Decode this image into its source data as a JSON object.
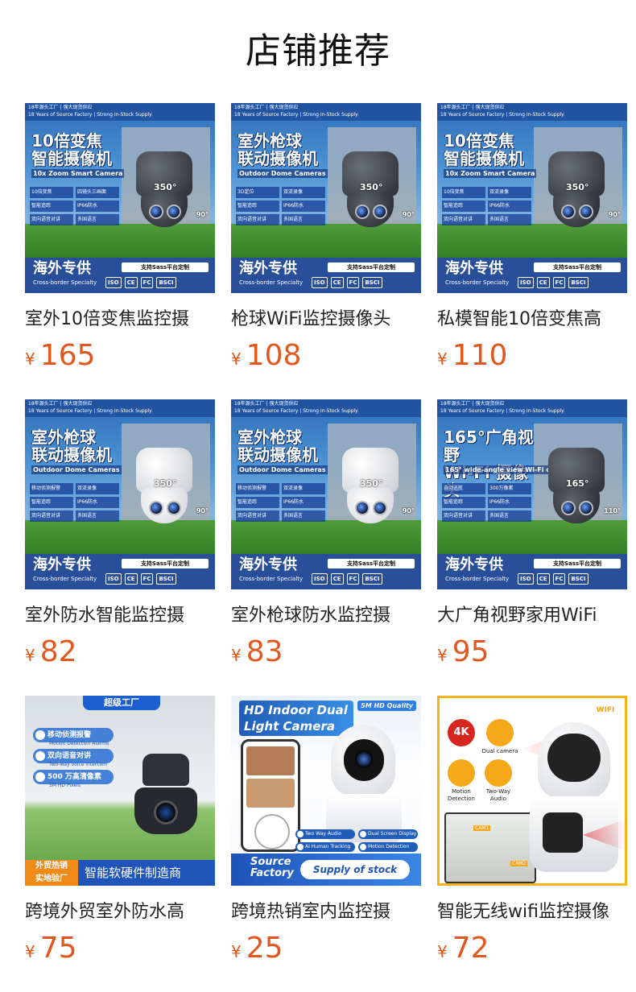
{
  "section_title": "店铺推荐",
  "currency_symbol": "¥",
  "products": [
    {
      "name": "室外10倍变焦监控摄",
      "price": "165",
      "image": {
        "style": "banner",
        "top_line1": "18年源头工厂 | 强大现货供应",
        "top_line2": "18 Years of Source Factory | Strong In-Stock Supply",
        "headline": "10倍变焦\n智能摄像机",
        "subtitle": "10x Zoom Smart Camera",
        "features": [
          "10倍变焦",
          "四镜头三画面",
          "智能追踪",
          "IP66防水",
          "双向语音对讲",
          "多国语言"
        ],
        "angle": "350°",
        "angle2": "90°",
        "brand": "海外专供",
        "brand_sub": "Cross-border Specialty",
        "tag": "支持Sass平台定制",
        "certs": [
          "ISO",
          "CE",
          "FC",
          "BSCI"
        ],
        "camera_color": "dark",
        "icon": "security-camera-icon"
      }
    },
    {
      "name": "枪球WiFi监控摄像头",
      "price": "108",
      "image": {
        "style": "banner",
        "top_line1": "18年源头工厂 | 强大现货供应",
        "top_line2": "18 Years of Source Factory | Strong In-Stock Supply",
        "headline": "室外枪球\n联动摄像机",
        "subtitle": "Outdoor Dome Cameras",
        "features": [
          "3D定位",
          "双流录像",
          "智能追踪",
          "IP66防水",
          "双向语音对讲",
          "多国语言"
        ],
        "angle": "350°",
        "angle2": "90°",
        "brand": "海外专供",
        "brand_sub": "Cross-border Specialty",
        "tag": "支持Sass平台定制",
        "certs": [
          "ISO",
          "CE",
          "FC",
          "BSCI"
        ],
        "camera_color": "dark",
        "icon": "security-camera-icon"
      }
    },
    {
      "name": "私模智能10倍变焦高",
      "price": "110",
      "image": {
        "style": "banner",
        "top_line1": "18年源头工厂 | 强大现货供应",
        "top_line2": "18 Years of Source Factory | Strong In-Stock Supply",
        "headline": "10倍变焦\n智能摄像机",
        "subtitle": "10x Zoom Smart Camera",
        "features": [
          "10倍变焦",
          "双流录像",
          "智能追踪",
          "IP66防水",
          "双向语音对讲",
          "多国语言"
        ],
        "angle": "350°",
        "angle2": "90°",
        "brand": "海外专供",
        "brand_sub": "Cross-border Specialty",
        "tag": "支持Sass平台定制",
        "certs": [
          "ISO",
          "CE",
          "FC",
          "BSCI"
        ],
        "camera_color": "dark",
        "icon": "security-camera-icon"
      }
    },
    {
      "name": "室外防水智能监控摄",
      "price": "82",
      "image": {
        "style": "banner",
        "top_line1": "18年源头工厂 | 强大现货供应",
        "top_line2": "18 Years of Source Factory | Strong In-Stock Supply",
        "headline": "室外枪球\n联动摄像机",
        "subtitle": "Outdoor Dome Cameras",
        "features": [
          "移动侦测报警",
          "双流录像",
          "智能追踪",
          "IP66防水",
          "双向语音对讲",
          "多国语言"
        ],
        "angle": "350°",
        "angle2": "90°",
        "brand": "海外专供",
        "brand_sub": "Cross-border Specialty",
        "tag": "支持Sass平台定制",
        "certs": [
          "ISO",
          "CE",
          "FC",
          "BSCI"
        ],
        "camera_color": "white",
        "icon": "security-camera-icon"
      }
    },
    {
      "name": "室外枪球防水监控摄",
      "price": "83",
      "image": {
        "style": "banner",
        "top_line1": "18年源头工厂 | 强大现货供应",
        "top_line2": "18 Years of Source Factory | Strong In-Stock Supply",
        "headline": "室外枪球\n联动摄像机",
        "subtitle": "Outdoor Dome Cameras",
        "features": [
          "移动侦测报警",
          "双流录像",
          "智能追踪",
          "IP66防水",
          "双向语音对讲",
          "多国语言"
        ],
        "angle": "350°",
        "angle2": "90°",
        "brand": "海外专供",
        "brand_sub": "Cross-border Specialty",
        "tag": "支持Sass平台定制",
        "certs": [
          "ISO",
          "CE",
          "FC",
          "BSCI"
        ],
        "camera_color": "white",
        "icon": "security-camera-icon"
      }
    },
    {
      "name": "大广角视野家用WiFi",
      "price": "95",
      "image": {
        "style": "banner",
        "top_line1": "18年源头工厂 | 强大现货供应",
        "top_line2": "18 Years of Source Factory | Strong In-Stock Supply",
        "headline": "165°广角视野\nWi-Fi 摄像头",
        "subtitle": "165° wide-angle view Wi-Fi camera",
        "features": [
          "自动巡航",
          "300万像素",
          "智能追踪",
          "IP66防水",
          "双向语音对讲",
          "多国语言"
        ],
        "angle": "165°",
        "angle2": "110°",
        "brand": "海外专供",
        "brand_sub": "Cross-border Specialty",
        "tag": "支持Sass平台定制",
        "certs": [
          "ISO",
          "CE",
          "FC",
          "BSCI"
        ],
        "camera_color": "dark",
        "icon": "security-camera-icon"
      }
    },
    {
      "name": "跨境外贸室外防水高",
      "price": "75",
      "image": {
        "style": "t7",
        "badge": "超级工厂",
        "pills": [
          {
            "cn": "移动侦测报警",
            "en": "Motion Detection Alarms"
          },
          {
            "cn": "双向语音对讲",
            "en": "Two-way voice intercom"
          },
          {
            "cn": "500 万高清像素",
            "en": "5M HD Pixels"
          }
        ],
        "foot_left": "外贸热销\n实地验厂",
        "foot_right": "智能软硬件制造商",
        "icon": "security-camera-icon"
      }
    },
    {
      "name": "跨境热销室内监控摄",
      "price": "25",
      "image": {
        "style": "t8",
        "title": "HD Indoor Dual Light Camera",
        "badge": "5M HD Quality",
        "chips": [
          "Two Way Audio",
          "Dual Screen Display",
          "AI Human Tracking",
          "Motion Detection"
        ],
        "source": "Source Factory",
        "supply": "Supply of stock",
        "icon": "indoor-camera-icon"
      }
    },
    {
      "name": "智能无线wifi监控摄像",
      "price": "72",
      "image": {
        "style": "t9",
        "k4": "4K",
        "icons": [
          {
            "label": "Dual camera",
            "icon": "dual-camera-icon"
          },
          {
            "label": "Motion Detection",
            "icon": "motion-icon"
          },
          {
            "label": "Two-Way Audio",
            "icon": "microphone-icon"
          }
        ],
        "wifi": "WIFI",
        "cam1": "CAM1",
        "cam2": "CAM2",
        "icon": "dual-lens-camera-icon"
      }
    }
  ],
  "colors": {
    "price": "#e2571e",
    "title": "#111111",
    "banner_blue": "#2a4f9a",
    "accent_orange": "#f08a18"
  }
}
